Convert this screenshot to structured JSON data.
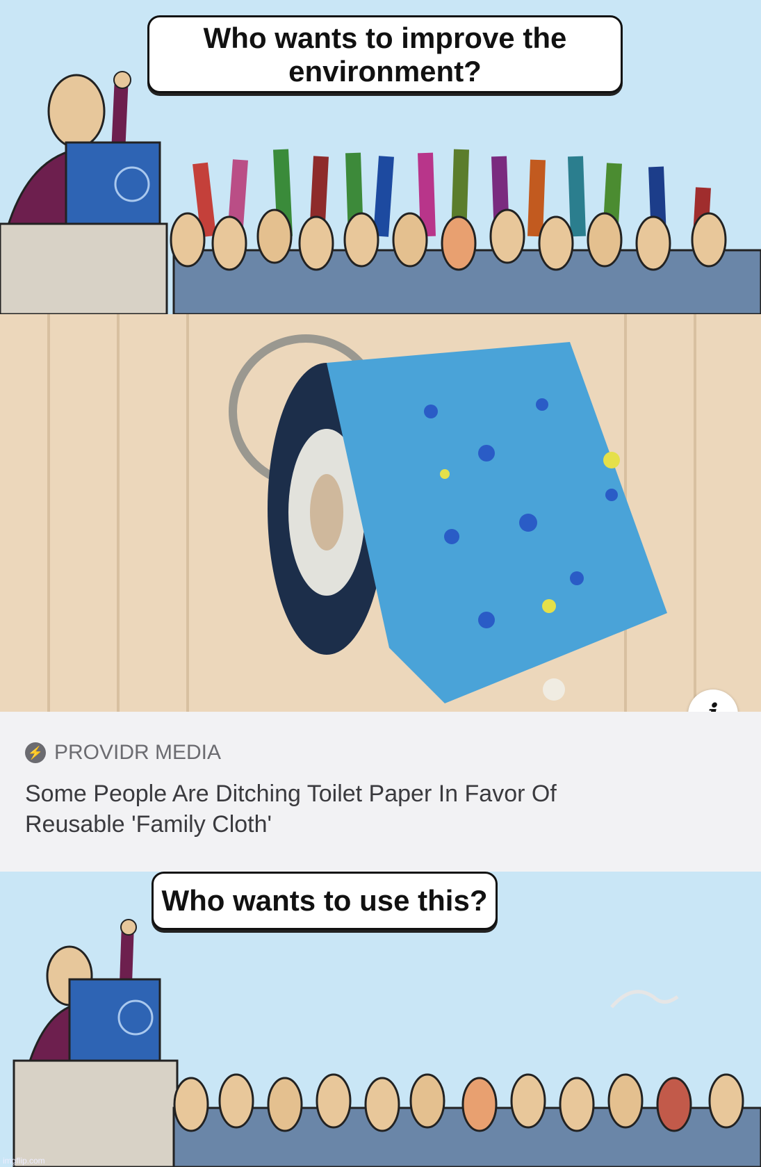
{
  "panel1": {
    "bubble_text": "Who wants to improve the environment?"
  },
  "article": {
    "source_icon": "lightning-icon",
    "source": "PROVIDR MEDIA",
    "headline_line1": "Some People Are Ditching Toilet Paper In Favor Of",
    "headline_line2": "Reusable 'Family Cloth'",
    "info_label": "i"
  },
  "panel3": {
    "bubble_text": "Who wants to use this?"
  },
  "watermark": "imgflip.com"
}
